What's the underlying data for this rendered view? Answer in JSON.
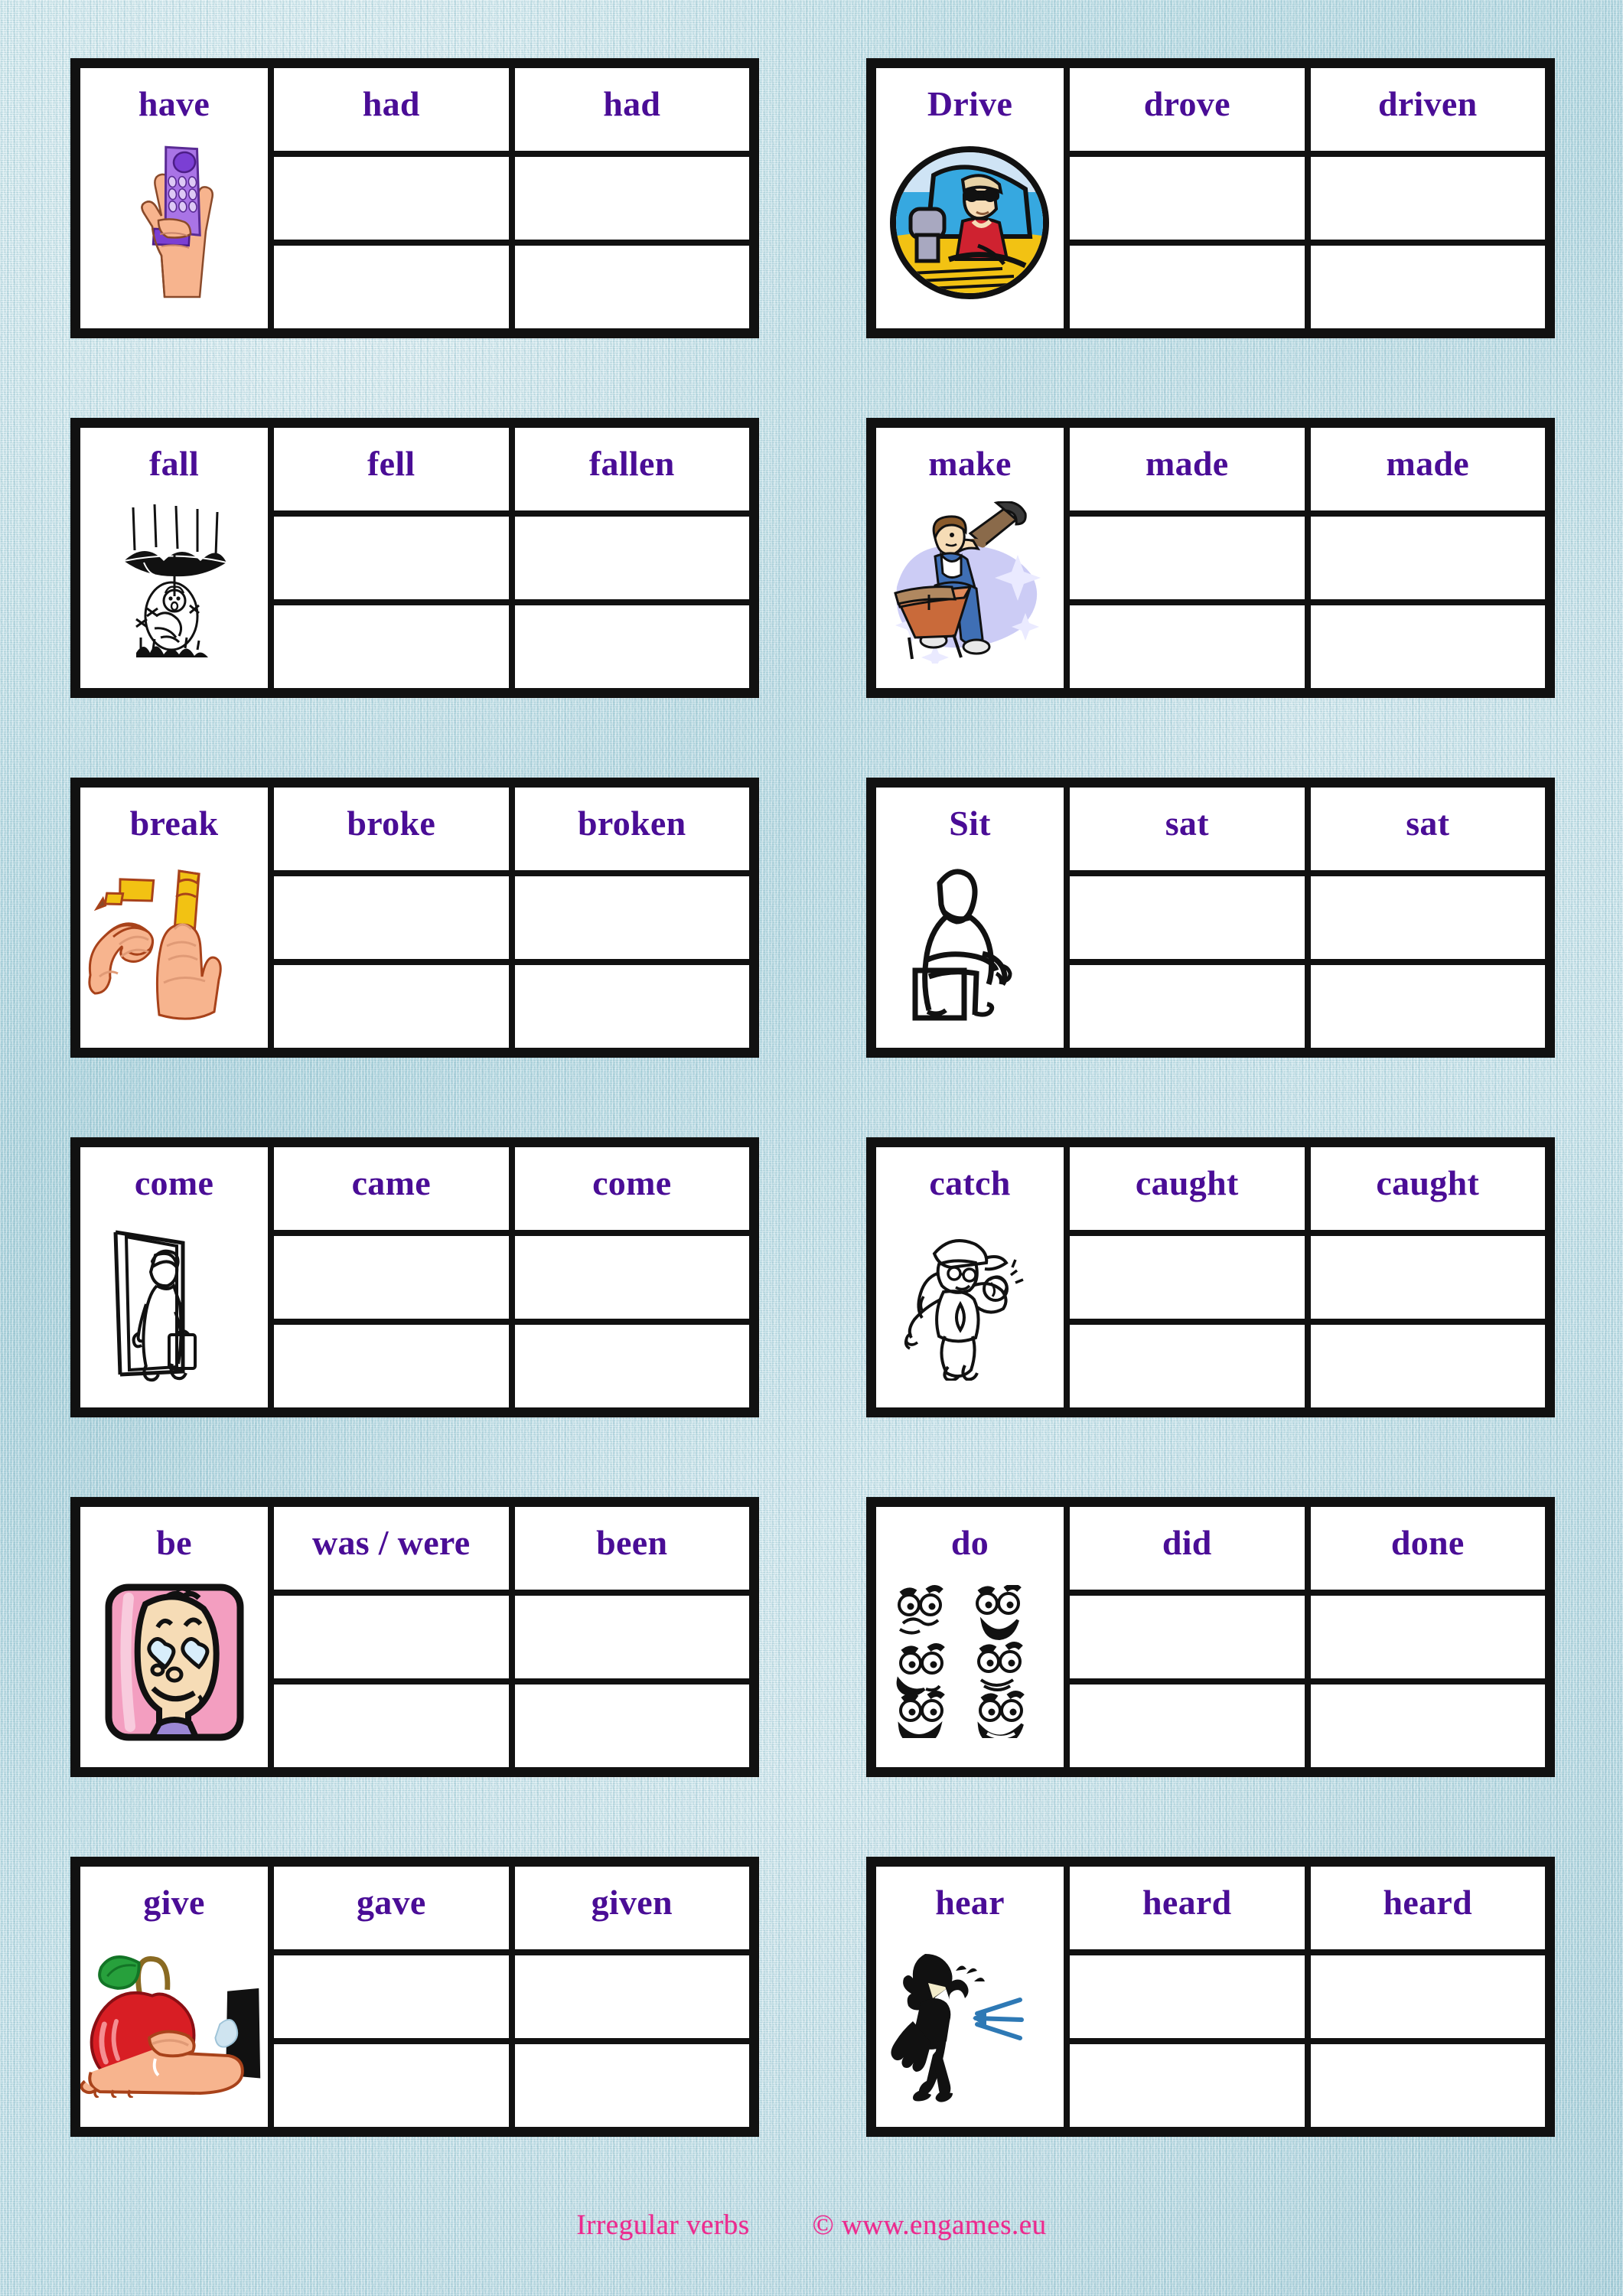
{
  "page": {
    "title": "Irregular verbs",
    "background_color": "#c3e0e7",
    "word_color": "#4a0d96",
    "footer_color": "#ec2a8e",
    "border_color": "#111111"
  },
  "footer": {
    "left_text": "Irregular verbs",
    "right_text": "© www.engames.eu"
  },
  "cards": [
    {
      "base": "have",
      "past_simple": "had",
      "past_participle": "had",
      "image_name": "hand-holding-phone-icon",
      "image_description": "A hand holding a purple cordless telephone"
    },
    {
      "base": "Drive",
      "past_simple": "drove",
      "past_participle": "driven",
      "image_name": "person-driving-car-icon",
      "image_description": "Oval picture of a person with sunglasses driving a car"
    },
    {
      "base": "fall",
      "past_simple": "fell",
      "past_participle": "fallen",
      "image_name": "person-falling-umbrella-icon",
      "image_description": "Line drawing of a person falling while holding an inverted umbrella"
    },
    {
      "base": "make",
      "past_simple": "made",
      "past_participle": "made",
      "image_name": "carpenter-hammering-icon",
      "image_description": "Cartoon carpenter hammering a nail into a workbench"
    },
    {
      "base": "break",
      "past_simple": "broke",
      "past_participle": "broken",
      "image_name": "hands-breaking-pencil-icon",
      "image_description": "Two hands snapping a yellow pencil in half"
    },
    {
      "base": "Sit",
      "past_simple": "sat",
      "past_participle": "sat",
      "image_name": "person-sitting-icon",
      "image_description": "Line drawing of a figure sitting on a box"
    },
    {
      "base": "come",
      "past_simple": "came",
      "past_participle": "come",
      "image_name": "woman-entering-door-icon",
      "image_description": "Line drawing of a woman with a briefcase walking through a doorway"
    },
    {
      "base": "catch",
      "past_simple": "caught",
      "past_participle": "caught",
      "image_name": "girl-catching-ball-icon",
      "image_description": "Line drawing of a girl in a cap catching a ball in a glove"
    },
    {
      "base": "be",
      "past_simple": "was / were",
      "past_participle": "been",
      "image_name": "face-heart-eyes-icon",
      "image_description": "Cartoon face with heart-shaped eyes on a pink panel"
    },
    {
      "base": "do",
      "past_simple": "did",
      "past_participle": "done",
      "image_name": "cartoon-faces-icon",
      "image_description": "Six black and white cartoon faces with expressions"
    },
    {
      "base": "give",
      "past_simple": "gave",
      "past_participle": "given",
      "image_name": "hand-offering-apple-icon",
      "image_description": "A hand in a black sleeve offering a red apple with a green leaf"
    },
    {
      "base": "hear",
      "past_simple": "heard",
      "past_participle": "heard",
      "image_name": "person-listening-icon",
      "image_description": "Black silhouette of a person cupping a hand to their ear with blue sound lines"
    }
  ]
}
